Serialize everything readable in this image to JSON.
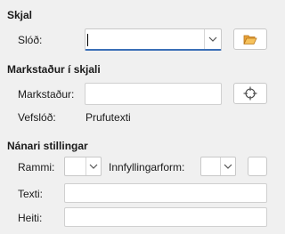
{
  "file_section": {
    "title": "Skjal",
    "path_label": "Slóð:",
    "path_value": ""
  },
  "bookmark_section": {
    "title": "Markstaður í skjali",
    "bookmark_label": "Markstaður:",
    "bookmark_value": "",
    "url_label": "Vefslóð:",
    "url_value": "Prufutexti"
  },
  "details_section": {
    "title": "Nánari stillingar",
    "frame_label": "Rammi:",
    "frame_value": "",
    "form_label": "Innfyllingarform:",
    "form_value": "",
    "text_label": "Texti:",
    "text_value": "",
    "name_label": "Heiti:",
    "name_value": ""
  },
  "icons": {
    "open_file": "folder-open-icon",
    "target": "target-icon",
    "dropdown": "chevron-down-icon"
  },
  "colors": {
    "background": "#f0f0f0",
    "focus_underline": "#3a6fb7",
    "folder": "#e8a23a"
  }
}
